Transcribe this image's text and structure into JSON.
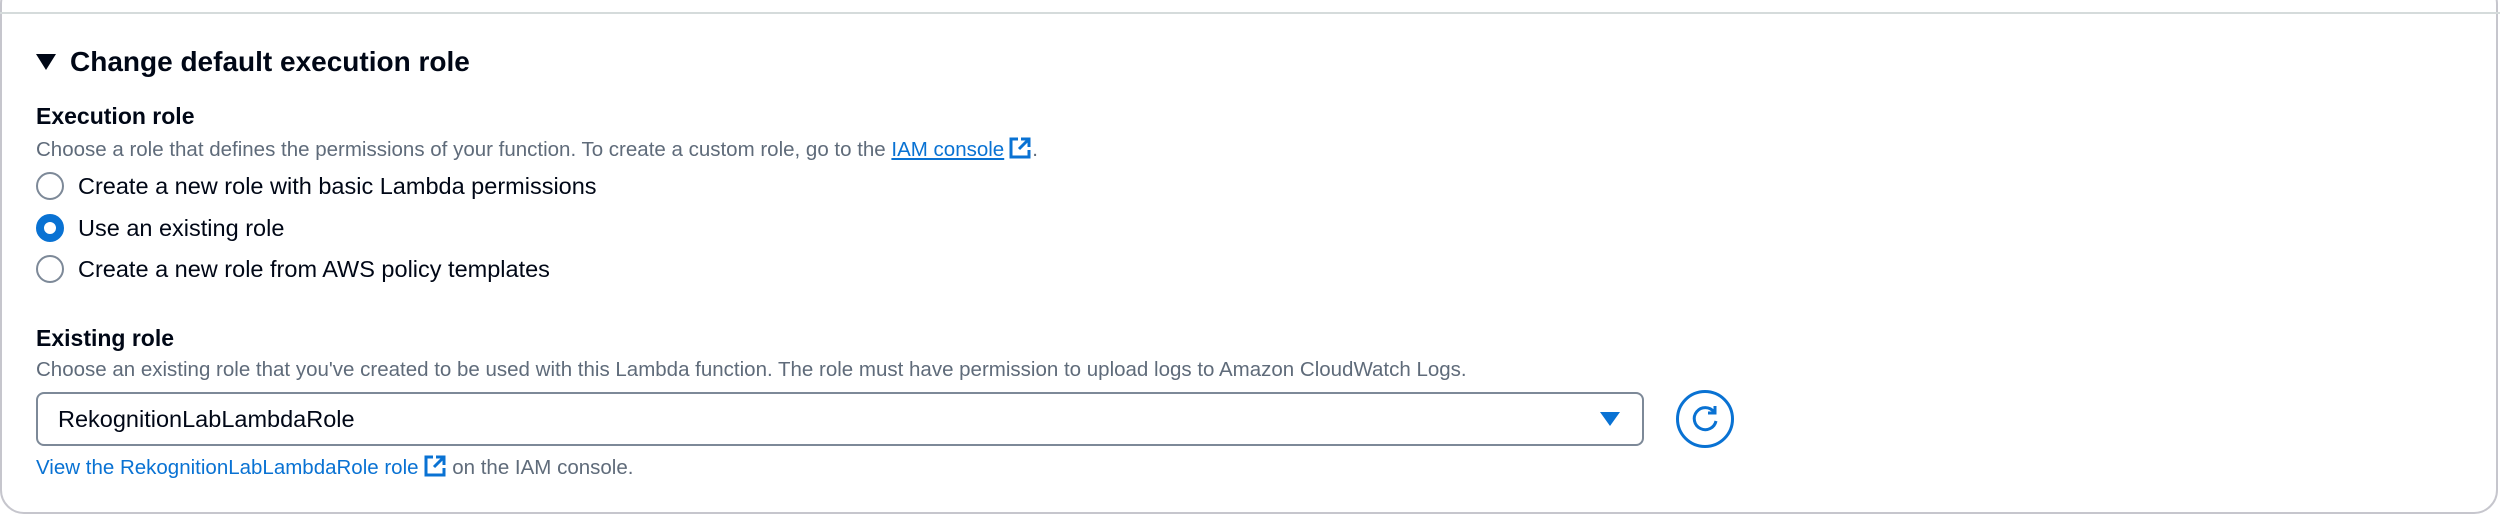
{
  "section": {
    "title": "Change default execution role",
    "icon": "caret-down-icon"
  },
  "execution_role": {
    "label": "Execution role",
    "description": "Choose a role that defines the permissions of your function. To create a custom role, go to the ",
    "iam_link": "IAM console",
    "description_end": ".",
    "options": [
      {
        "label": "Create a new role with basic Lambda permissions",
        "checked": false
      },
      {
        "label": "Use an existing role",
        "checked": true
      },
      {
        "label": "Create a new role from AWS policy templates",
        "checked": false
      }
    ]
  },
  "existing_role": {
    "label": "Existing role",
    "description": "Choose an existing role that you've created to be used with this Lambda function. The role must have permission to upload logs to Amazon CloudWatch Logs.",
    "selected": "RekognitionLabLambdaRole",
    "view_link": "View the RekognitionLabLambdaRole role",
    "view_suffix": " on the IAM console."
  },
  "colors": {
    "accent": "#0972d3",
    "text": "#000716",
    "secondary_text": "#5f6b7a",
    "border": "#7d8998"
  }
}
